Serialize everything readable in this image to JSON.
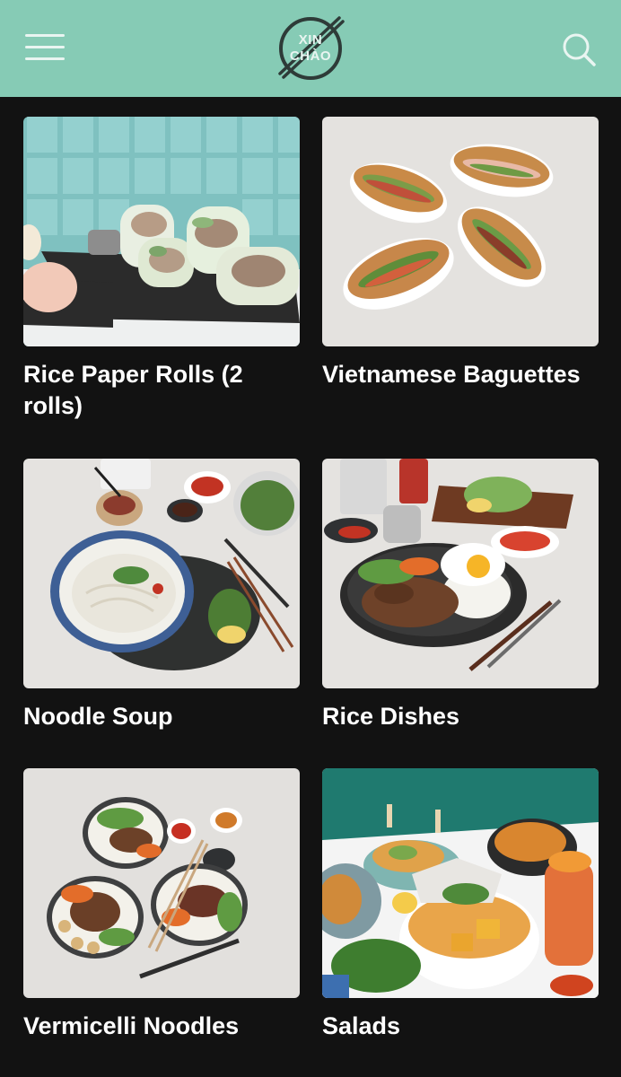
{
  "header": {
    "logo_line1": "XIN",
    "logo_line2": "CHÀO",
    "background": "#86cbb5",
    "menu_icon": "hamburger-menu-icon",
    "search_icon": "search-icon"
  },
  "categories": [
    {
      "title": "Rice Paper Rolls (2 rolls)",
      "image": "rice-paper-rolls-photo"
    },
    {
      "title": "Vietnamese Baguettes",
      "image": "vietnamese-baguettes-photo"
    },
    {
      "title": "Noodle Soup",
      "image": "noodle-soup-photo"
    },
    {
      "title": "Rice Dishes",
      "image": "rice-dishes-photo"
    },
    {
      "title": "Vermicelli Noodles",
      "image": "vermicelli-noodles-photo"
    },
    {
      "title": "Salads",
      "image": "salads-photo"
    }
  ]
}
